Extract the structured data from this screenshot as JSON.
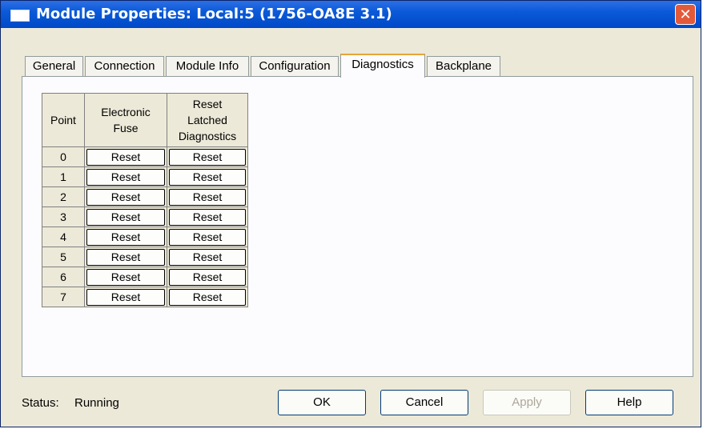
{
  "window": {
    "title": "Module Properties: Local:5 (1756-OA8E 3.1)",
    "close_glyph": "✕"
  },
  "tabs": [
    {
      "label": "General"
    },
    {
      "label": "Connection"
    },
    {
      "label": "Module Info"
    },
    {
      "label": "Configuration"
    },
    {
      "label": "Diagnostics",
      "active": true
    },
    {
      "label": "Backplane"
    }
  ],
  "table": {
    "headers": {
      "point": "Point",
      "fuse": "Electronic Fuse",
      "latched": "Reset Latched Diagnostics"
    },
    "rows": [
      {
        "point": "0",
        "fuse": "Reset",
        "latched": "Reset"
      },
      {
        "point": "1",
        "fuse": "Reset",
        "latched": "Reset"
      },
      {
        "point": "2",
        "fuse": "Reset",
        "latched": "Reset"
      },
      {
        "point": "3",
        "fuse": "Reset",
        "latched": "Reset"
      },
      {
        "point": "4",
        "fuse": "Reset",
        "latched": "Reset"
      },
      {
        "point": "5",
        "fuse": "Reset",
        "latched": "Reset"
      },
      {
        "point": "6",
        "fuse": "Reset",
        "latched": "Reset"
      },
      {
        "point": "7",
        "fuse": "Reset",
        "latched": "Reset"
      }
    ]
  },
  "status": {
    "label": "Status:",
    "value": "Running"
  },
  "buttons": {
    "ok": "OK",
    "cancel": "Cancel",
    "apply": "Apply",
    "help": "Help"
  },
  "colors": {
    "titlebar": "#0a5ad8",
    "dialog_bg": "#ece9d8",
    "active_tab_accent": "#e8a53a",
    "close_button": "#e35a3a"
  }
}
